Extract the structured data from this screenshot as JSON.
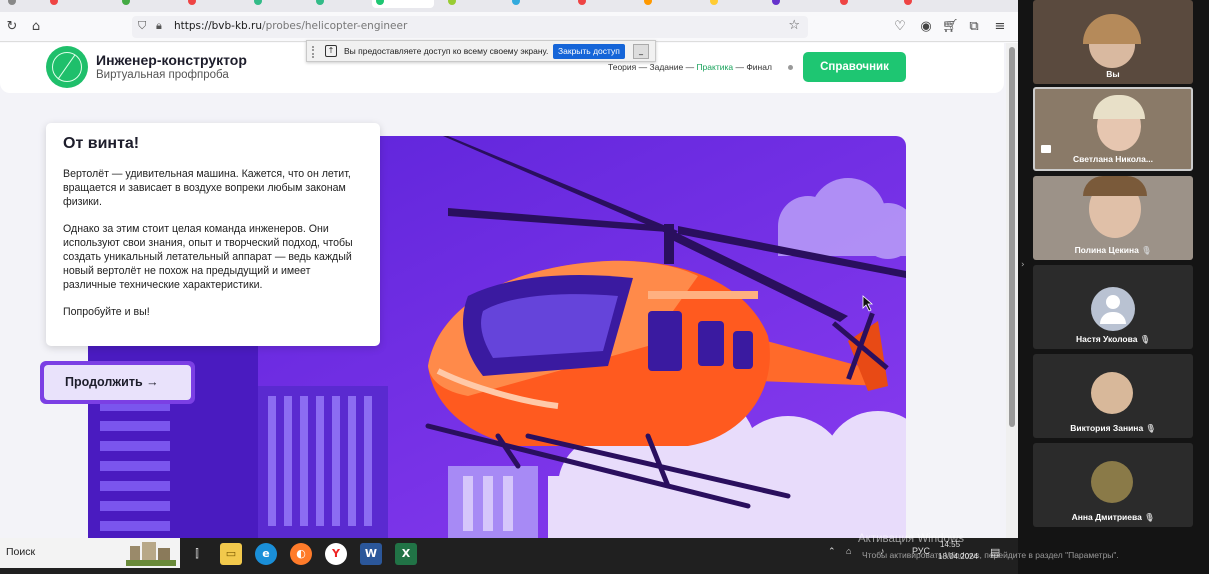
{
  "browser": {
    "url_host": "https://bvb-kb.ru",
    "url_path": "/probes/helicopter-engineer"
  },
  "site": {
    "title": "Инженер-конструктор",
    "subtitle": "Виртуальная профпроба",
    "steps": [
      "Теория",
      "Задание",
      "Практика",
      "Финал"
    ],
    "current_step": "Практика",
    "reference_button": "Справочник"
  },
  "share_bar": {
    "text": "Вы предоставляете доступ ко всему своему экрану.",
    "close_button": "Закрыть доступ",
    "minimize": "_"
  },
  "card": {
    "title": "От винта!",
    "p1": "Вертолёт — удивительная машина. Кажется, что он летит, вращается и зависает в воздухе вопреки любым законам физики.",
    "p2": "Однако за этим стоит целая команда инженеров. Они используют свои знания, опыт и творческий подход, чтобы создать уникальный летательный аппарат — ведь каждый новый вертолёт не похож на предыдущий и имеет различные технические характеристики.",
    "p3": "Попробуйте и вы!"
  },
  "continue_button": "Продолжить →",
  "taskbar": {
    "search": "Поиск",
    "lang": "РУС",
    "time": "14:55",
    "date": "18.04.2024"
  },
  "watermark": {
    "line1": "Активация Windows",
    "line2": "Чтобы активировать Windows, перейдите в раздел \"Параметры\"."
  },
  "participants": [
    {
      "name": "Вы"
    },
    {
      "name": "Светлана Никола..."
    },
    {
      "name": "Полина Цекина"
    },
    {
      "name": "Настя Уколова"
    },
    {
      "name": "Виктория Занина"
    },
    {
      "name": "Анна Дмитриева"
    }
  ],
  "colors": {
    "brand_green": "#1ec672",
    "hero_purple": "#6b2fe0",
    "helicopter_orange": "#ff5a1f",
    "button_purple": "#7b3fe4"
  }
}
